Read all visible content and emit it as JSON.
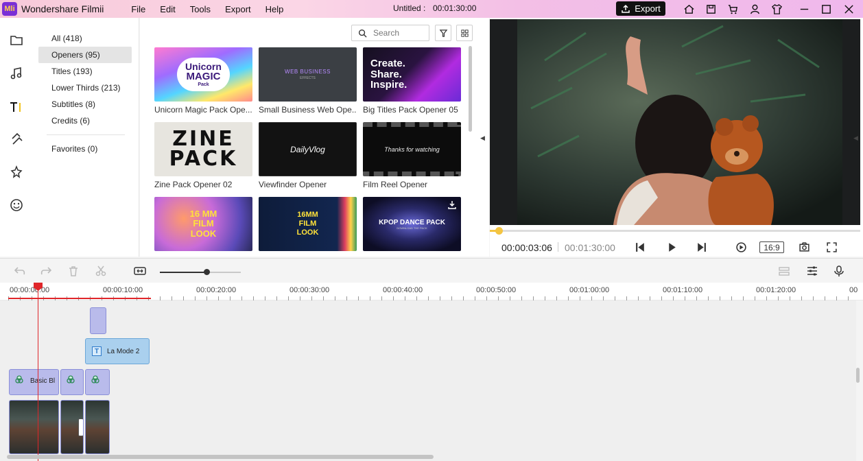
{
  "app": {
    "name": "Wondershare Filmii",
    "logo_text": "Mli",
    "menu": [
      "File",
      "Edit",
      "Tools",
      "Export",
      "Help"
    ],
    "project_title": "Untitled :",
    "project_duration": "00:01:30:00",
    "export_label": "Export"
  },
  "rail": {
    "icons": [
      "folder-icon",
      "music-icon",
      "titles-icon",
      "transitions-icon",
      "effects-icon",
      "stickers-icon"
    ],
    "active": "titles-icon"
  },
  "categories": {
    "items": [
      {
        "label": "All (418)"
      },
      {
        "label": "Openers (95)",
        "active": true
      },
      {
        "label": "Titles (193)"
      },
      {
        "label": "Lower Thirds (213)"
      },
      {
        "label": "Subtitles (8)"
      },
      {
        "label": "Credits (6)"
      }
    ],
    "favorites": "Favorites (0)"
  },
  "library": {
    "search_placeholder": "Search",
    "thumbnails": [
      {
        "label": "Unicorn Magic Pack Ope...",
        "art_lines": [
          "Unicorn",
          "MAGIC",
          "Pack"
        ]
      },
      {
        "label": "Small Business Web Ope...",
        "art_lines": [
          "WEB BUSINESS",
          "EFFECTS"
        ]
      },
      {
        "label": "Big Titles Pack Opener 05",
        "art_lines": [
          "Create.",
          "Share.",
          "Inspire."
        ]
      },
      {
        "label": "Zine Pack Opener 02",
        "art_lines": [
          "ZINE",
          "PACK"
        ]
      },
      {
        "label": "Viewfinder Opener",
        "art_lines": [
          "DailyVlog"
        ]
      },
      {
        "label": "Film Reel Opener",
        "art_lines": [
          "Thanks for watching"
        ]
      },
      {
        "label": "",
        "art_lines": [
          "16 MM",
          "FILM",
          "LOOK"
        ]
      },
      {
        "label": "",
        "art_lines": [
          "16MM",
          "FILM",
          "LOOK"
        ]
      },
      {
        "label": "",
        "art_lines": [
          "KPOP DANCE PACK",
          "DOWNLOAD THE PACK"
        ]
      }
    ]
  },
  "preview": {
    "current_time": "00:00:03:06",
    "total_time": "00:01:30:00",
    "aspect_ratio": "16:9",
    "playback_progress": 0.024
  },
  "timeline": {
    "zoom_level": 0.58,
    "ruler_labels": [
      "00:00:00:00",
      "00:00:10:00",
      "00:00:20:00",
      "00:00:30:00",
      "00:00:40:00",
      "00:00:50:00",
      "00:01:00:00",
      "00:01:10:00",
      "00:01:20:00",
      "00"
    ],
    "title_clip": "La Mode 2",
    "effect_clip": "Basic Bl",
    "accent_color": "#e0262a"
  }
}
